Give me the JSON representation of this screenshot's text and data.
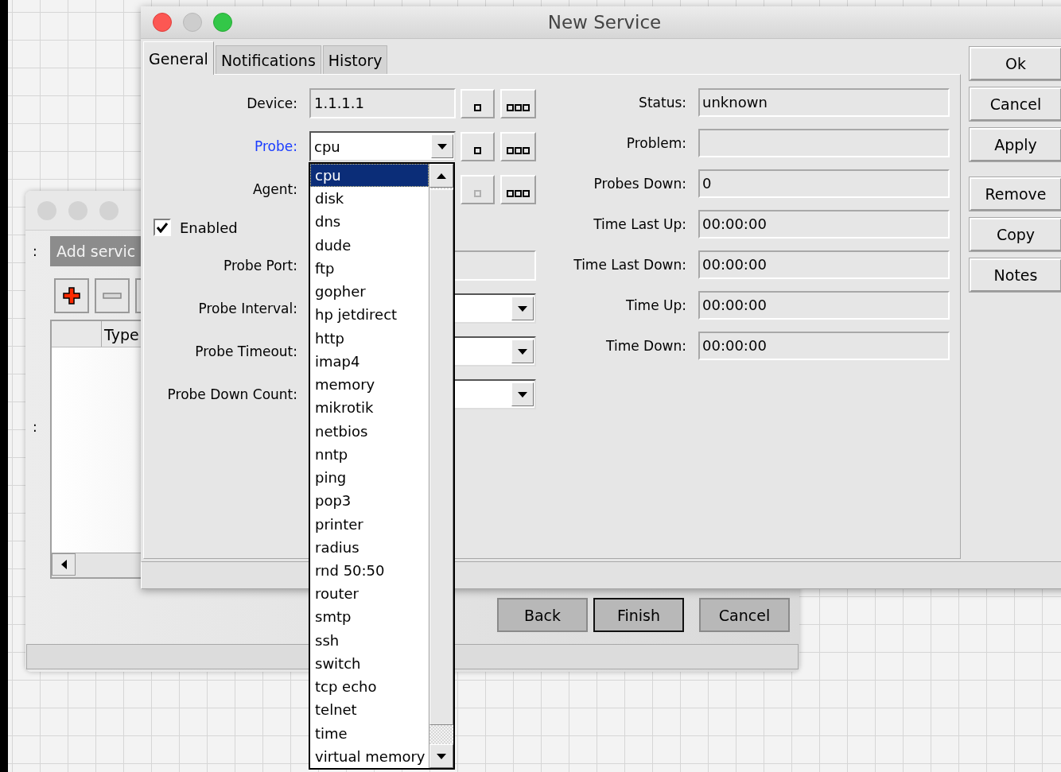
{
  "background_window": {
    "header_marker": ":",
    "header": "Add servic",
    "table": {
      "columns": [
        "Type"
      ]
    },
    "table_marker": ":",
    "buttons": [
      {
        "label": "Back",
        "default": false
      },
      {
        "label": "Finish",
        "default": true
      },
      {
        "label": "Cancel",
        "default": false
      }
    ]
  },
  "window": {
    "title": "New Service"
  },
  "tabs": [
    {
      "label": "General",
      "selected": true
    },
    {
      "label": "Notifications",
      "selected": false
    },
    {
      "label": "History",
      "selected": false
    }
  ],
  "form_left": [
    {
      "kind": "text",
      "label": "Device:",
      "value": "1.1.1.1",
      "highlighted": false,
      "pickers": true,
      "picker_disabled": false
    },
    {
      "kind": "select",
      "label": "Probe:",
      "value": "cpu",
      "highlighted": true,
      "pickers": true,
      "picker_disabled": false,
      "open": true,
      "options": [
        {
          "label": "cpu",
          "selected": true
        },
        {
          "label": "disk",
          "selected": false
        },
        {
          "label": "dns",
          "selected": false
        },
        {
          "label": "dude",
          "selected": false
        },
        {
          "label": "ftp",
          "selected": false
        },
        {
          "label": "gopher",
          "selected": false
        },
        {
          "label": "hp jetdirect",
          "selected": false
        },
        {
          "label": "http",
          "selected": false
        },
        {
          "label": "imap4",
          "selected": false
        },
        {
          "label": "memory",
          "selected": false
        },
        {
          "label": "mikrotik",
          "selected": false
        },
        {
          "label": "netbios",
          "selected": false
        },
        {
          "label": "nntp",
          "selected": false
        },
        {
          "label": "ping",
          "selected": false
        },
        {
          "label": "pop3",
          "selected": false
        },
        {
          "label": "printer",
          "selected": false
        },
        {
          "label": "radius",
          "selected": false
        },
        {
          "label": "rnd 50:50",
          "selected": false
        },
        {
          "label": "router",
          "selected": false
        },
        {
          "label": "smtp",
          "selected": false
        },
        {
          "label": "ssh",
          "selected": false
        },
        {
          "label": "switch",
          "selected": false
        },
        {
          "label": "tcp echo",
          "selected": false
        },
        {
          "label": "telnet",
          "selected": false
        },
        {
          "label": "time",
          "selected": false
        },
        {
          "label": "virtual memory",
          "selected": false
        }
      ]
    },
    {
      "kind": "text",
      "label": "Agent:",
      "highlighted": false,
      "pickers": true,
      "picker_disabled": true,
      "covered": true
    },
    {
      "kind": "checkbox",
      "label": "Enabled",
      "checked": true
    },
    {
      "kind": "text",
      "label": "Probe Port:",
      "highlighted": false,
      "pickers": false
    },
    {
      "kind": "select",
      "label": "Probe Interval:",
      "highlighted": false,
      "pickers": false
    },
    {
      "kind": "select",
      "label": "Probe Timeout:",
      "highlighted": false,
      "pickers": false
    },
    {
      "kind": "select",
      "label": "Probe Down Count:",
      "highlighted": false,
      "pickers": false
    }
  ],
  "form_right": [
    {
      "label": "Status:",
      "value": "unknown"
    },
    {
      "label": "Problem:"
    },
    {
      "label": "Probes Down:",
      "value": "0"
    },
    {
      "label": "Time Last Up:",
      "value": "00:00:00"
    },
    {
      "label": "Time Last Down:",
      "value": "00:00:00"
    },
    {
      "label": "Time Up:",
      "value": "00:00:00"
    },
    {
      "label": "Time Down:",
      "value": "00:00:00"
    }
  ],
  "side_buttons": [
    [
      "Ok",
      "Cancel",
      "Apply"
    ],
    [
      "Remove",
      "Copy",
      "Notes"
    ]
  ]
}
